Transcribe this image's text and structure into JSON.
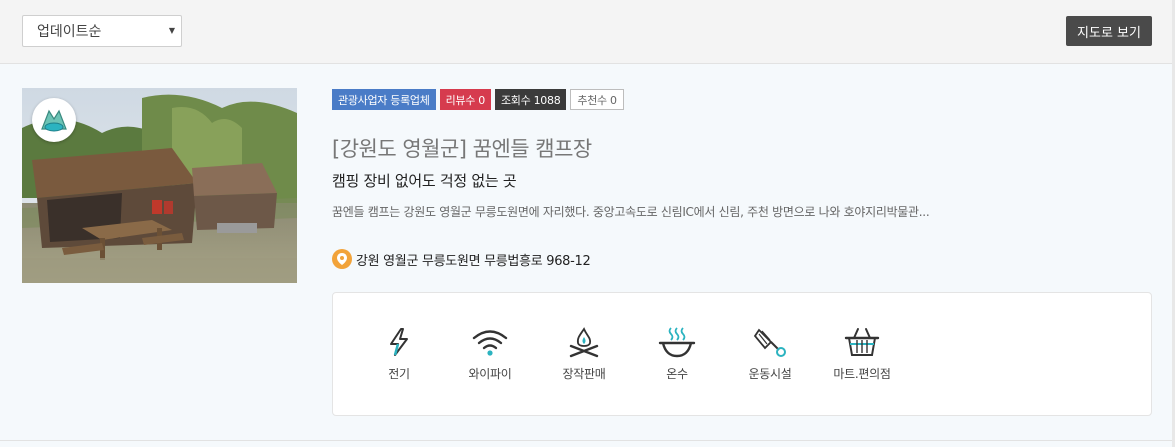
{
  "toolbar": {
    "sort_value": "업데이트순",
    "map_button": "지도로 보기"
  },
  "listing": {
    "badges": [
      {
        "label": "관광사업자 등록업체",
        "color": "#4a7cc7"
      },
      {
        "label": "리뷰수 0",
        "color": "#d63b4e"
      },
      {
        "label": "조회수 1088",
        "color": "#3b3b3b"
      },
      {
        "label": "추천수 0",
        "color": "#ffffff"
      }
    ],
    "title": "[강원도 영월군] 꿈엔들 캠프장",
    "subtitle": "캠핑 장비 없어도 걱정 없는 곳",
    "description": "꿈엔들 캠프는 강원도 영월군 무릉도원면에 자리했다. 중앙고속도로 신림IC에서 신림, 주천 방면으로 나와 호야지리박물관...",
    "address": "강원 영월군 무릉도원면 무릉법흥로 968-12",
    "amenities": [
      {
        "label": "전기",
        "icon": "lightning-icon"
      },
      {
        "label": "와이파이",
        "icon": "wifi-icon"
      },
      {
        "label": "장작판매",
        "icon": "campfire-icon"
      },
      {
        "label": "온수",
        "icon": "hot-water-icon"
      },
      {
        "label": "운동시설",
        "icon": "badminton-icon"
      },
      {
        "label": "마트.편의점",
        "icon": "basket-icon"
      }
    ]
  },
  "colors": {
    "accent_teal": "#2bb3c0",
    "pin_orange": "#f2a33a"
  }
}
